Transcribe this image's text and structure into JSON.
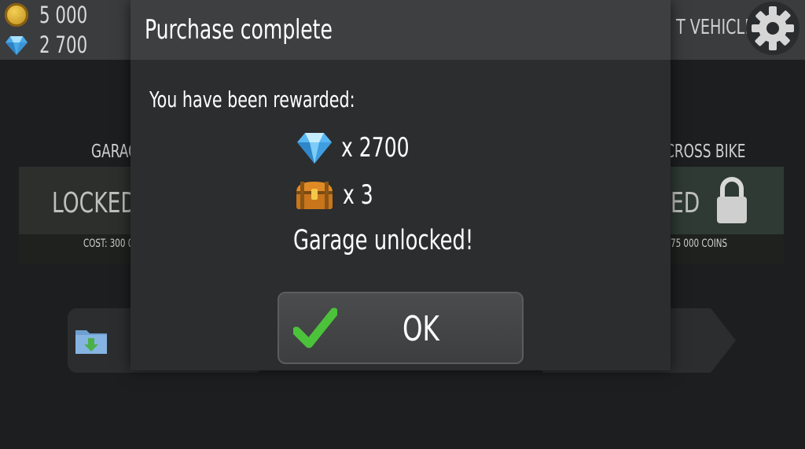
{
  "hud": {
    "coins": "5 000",
    "gems": "2 700",
    "next_vehicle_label": "T VEHICLE"
  },
  "background": {
    "left_section_title": "GARAG",
    "right_section_title": "CROSS BIKE",
    "left_card": {
      "status": "LOCKED",
      "cost": "COST: 300 0"
    },
    "right_card": {
      "status": "ED",
      "cost": "75 000 COINS"
    }
  },
  "dialog": {
    "title": "Purchase complete",
    "intro": "You have been rewarded:",
    "rewards": [
      {
        "icon": "diamond-icon",
        "quantity": "x 2700"
      },
      {
        "icon": "treasure-chest-icon",
        "quantity": "x 3"
      }
    ],
    "unlock_message": "Garage unlocked!",
    "ok_label": "OK"
  },
  "colors": {
    "dialog_bg": "#2b2d2f",
    "dialog_header": "#3d3f41",
    "check_green": "#4cc23a",
    "gem_blue": "#5ab8f0",
    "coin_gold": "#d4a52a"
  }
}
